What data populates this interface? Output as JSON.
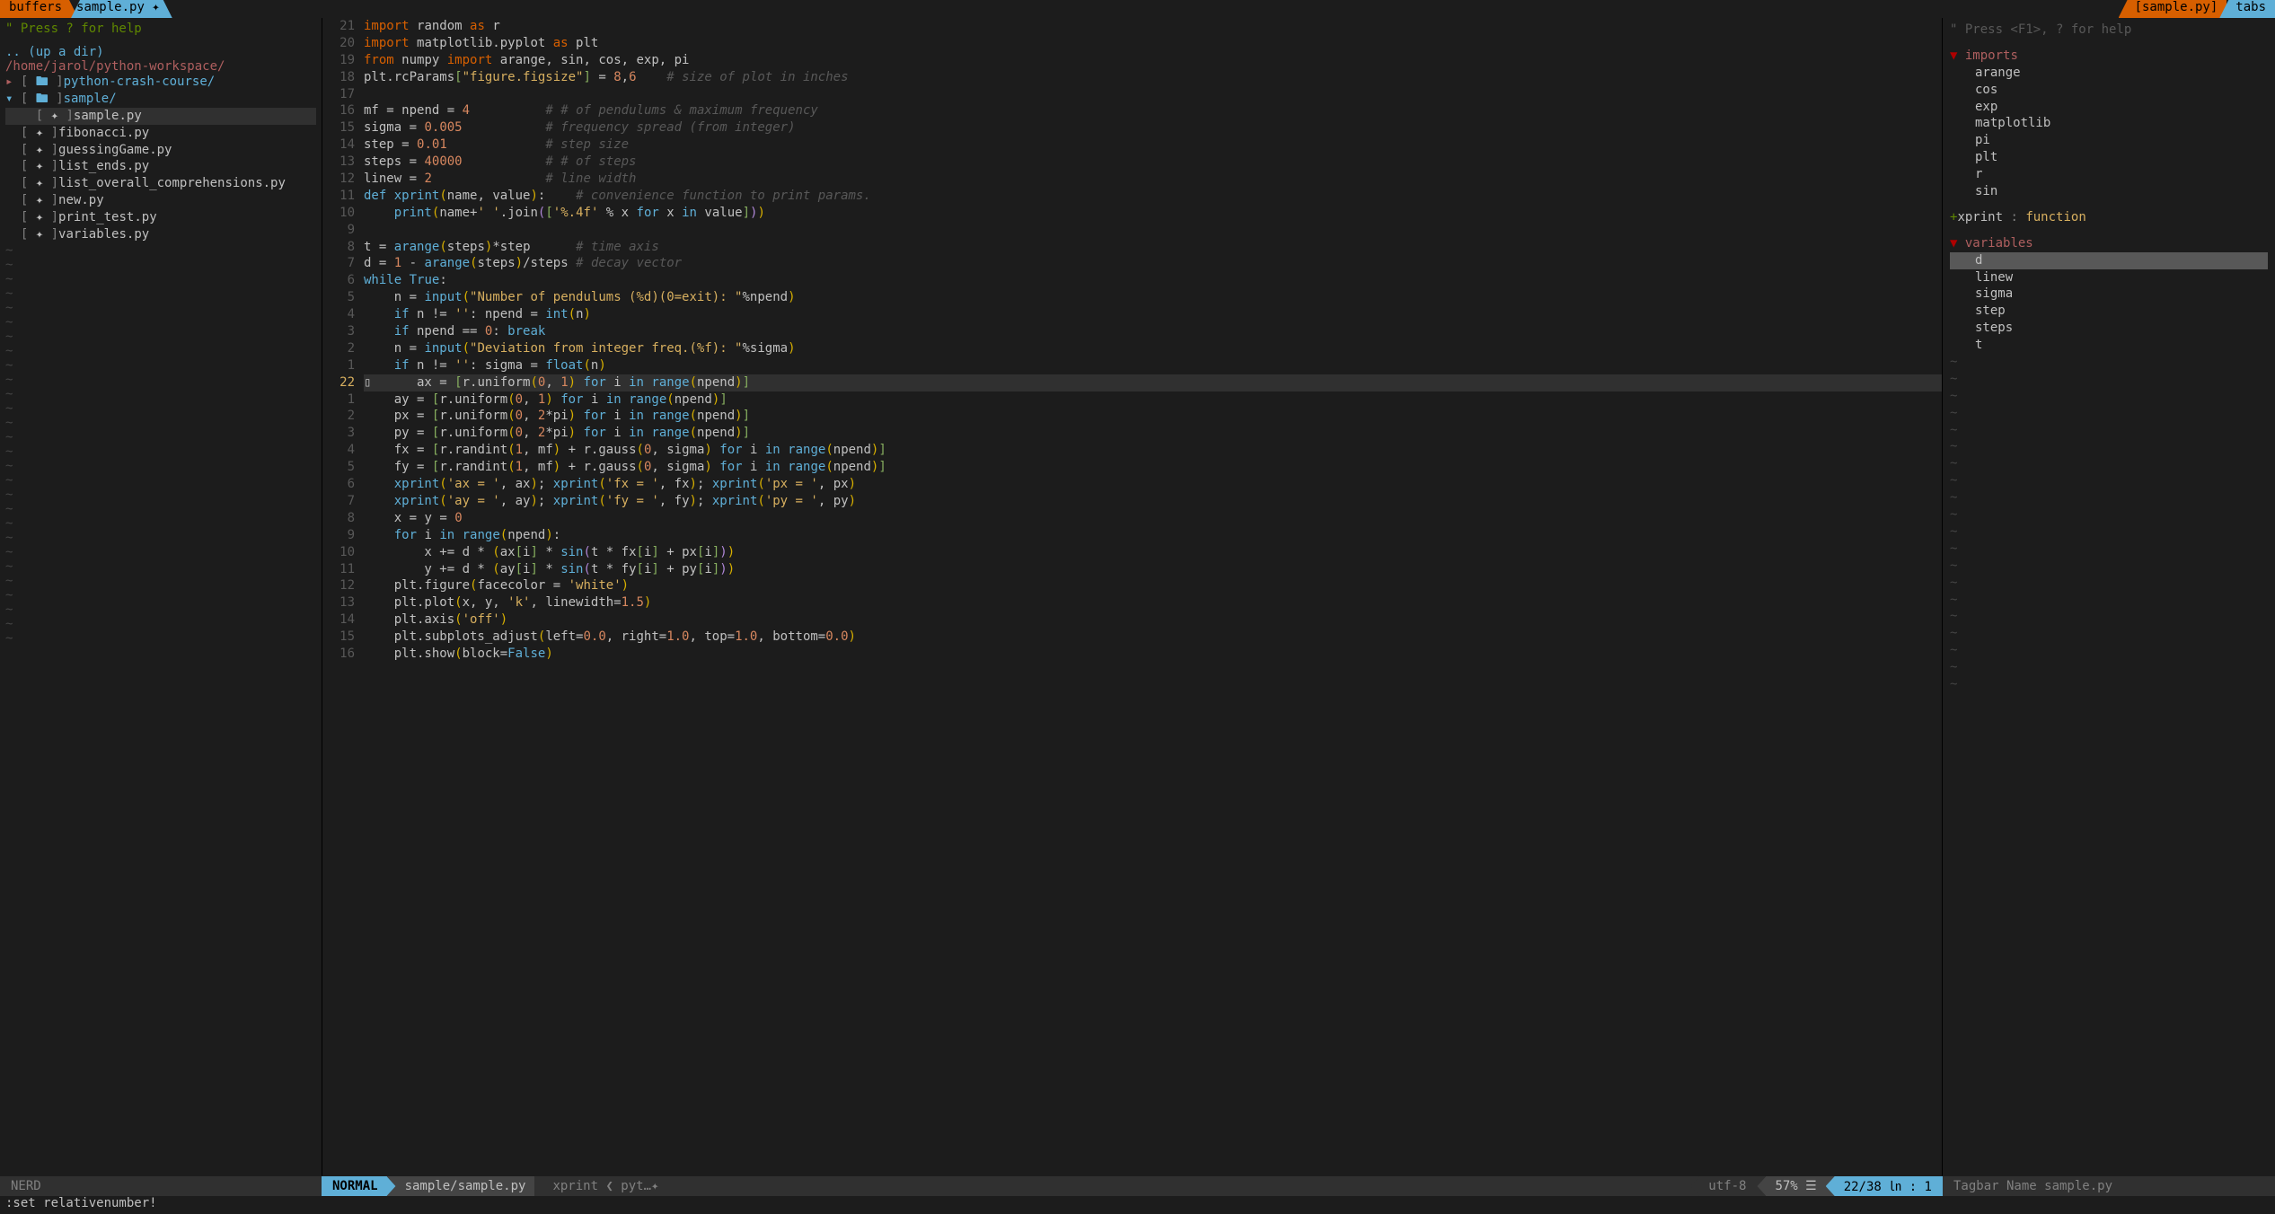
{
  "tabs": {
    "buffers_label": "buffers",
    "current_buffer": "sample.py ✦",
    "right_file": "[sample.py]",
    "tabs_label": "tabs"
  },
  "sidebar": {
    "help": "\" Press ? for help",
    "up_dir": ".. (up a dir)",
    "path": "/home/jarol/python-workspace/",
    "items": [
      {
        "type": "dir",
        "open": false,
        "label": "python-crash-course/"
      },
      {
        "type": "dir",
        "open": true,
        "label": "sample/"
      },
      {
        "type": "file",
        "selected": true,
        "label": "sample.py",
        "indent": 2
      },
      {
        "type": "file",
        "selected": false,
        "label": "fibonacci.py",
        "indent": 1
      },
      {
        "type": "file",
        "selected": false,
        "label": "guessingGame.py",
        "indent": 1
      },
      {
        "type": "file",
        "selected": false,
        "label": "list_ends.py",
        "indent": 1
      },
      {
        "type": "file",
        "selected": false,
        "label": "list_overall_comprehensions.py",
        "indent": 1
      },
      {
        "type": "file",
        "selected": false,
        "label": "new.py",
        "indent": 1
      },
      {
        "type": "file",
        "selected": false,
        "label": "print_test.py",
        "indent": 1
      },
      {
        "type": "file",
        "selected": false,
        "label": "variables.py",
        "indent": 1
      }
    ]
  },
  "editor": {
    "current_abs_line": 22,
    "lines": [
      {
        "n": "21",
        "html": "<span class='imp'>import</span> <span class='var'>random</span> <span class='imp'>as</span> <span class='var'>r</span>"
      },
      {
        "n": "20",
        "html": "<span class='imp'>import</span> <span class='var'>matplotlib.pyplot</span> <span class='imp'>as</span> <span class='var'>plt</span>"
      },
      {
        "n": "19",
        "html": "<span class='imp'>from</span> <span class='var'>numpy</span> <span class='imp'>import</span> <span class='var'>arange, sin, cos, exp, pi</span>"
      },
      {
        "n": "18",
        "html": "<span class='var'>plt.rcParams</span><span class='sq'>[</span><span class='str'>\"figure.figsize\"</span><span class='sq'>]</span> <span class='op'>=</span> <span class='num'>8</span>,<span class='num'>6</span>    <span class='cmt'># size of plot in inches</span>"
      },
      {
        "n": "17",
        "html": ""
      },
      {
        "n": "16",
        "html": "<span class='var'>mf</span> <span class='op'>=</span> <span class='var'>npend</span> <span class='op'>=</span> <span class='num'>4</span>          <span class='cmt'># # of pendulums &amp; maximum frequency</span>"
      },
      {
        "n": "15",
        "html": "<span class='var'>sigma</span> <span class='op'>=</span> <span class='num'>0.005</span>           <span class='cmt'># frequency spread (from integer)</span>"
      },
      {
        "n": "14",
        "html": "<span class='var'>step</span> <span class='op'>=</span> <span class='num'>0.01</span>             <span class='cmt'># step size</span>"
      },
      {
        "n": "13",
        "html": "<span class='var'>steps</span> <span class='op'>=</span> <span class='num'>40000</span>           <span class='cmt'># # of steps</span>"
      },
      {
        "n": "12",
        "html": "<span class='var'>linew</span> <span class='op'>=</span> <span class='num'>2</span>               <span class='cmt'># line width</span>"
      },
      {
        "n": "11",
        "html": "<span class='kw'>def</span> <span class='fn'>xprint</span><span class='br1'>(</span>name, value<span class='br1'>)</span>:    <span class='cmt'># convenience function to print params.</span>"
      },
      {
        "n": "10",
        "html": "    <span class='fn'>print</span><span class='br1'>(</span>name+<span class='str'>' '</span>.join<span class='br2'>(</span><span class='sq'>[</span><span class='str'>'%.4f'</span> % x <span class='kw'>for</span> x <span class='kw'>in</span> value<span class='sq'>]</span><span class='br2'>)</span><span class='br1'>)</span>"
      },
      {
        "n": "9",
        "html": ""
      },
      {
        "n": "8",
        "html": "<span class='var'>t</span> <span class='op'>=</span> <span class='fn'>arange</span><span class='br1'>(</span>steps<span class='br1'>)</span>*step      <span class='cmt'># time axis</span>"
      },
      {
        "n": "7",
        "html": "<span class='var'>d</span> <span class='op'>=</span> <span class='num'>1</span> - <span class='fn'>arange</span><span class='br1'>(</span>steps<span class='br1'>)</span>/steps <span class='cmt'># decay vector</span>"
      },
      {
        "n": "6",
        "html": "<span class='kw'>while</span> <span class='kw'>True</span>:"
      },
      {
        "n": "5",
        "html": "    n <span class='op'>=</span> <span class='fn'>input</span><span class='br1'>(</span><span class='str'>\"Number of pendulums (%d)(0=exit): \"</span>%npend<span class='br1'>)</span>"
      },
      {
        "n": "4",
        "html": "    <span class='kw'>if</span> n != <span class='str'>''</span>: npend <span class='op'>=</span> <span class='fn'>int</span><span class='br1'>(</span>n<span class='br1'>)</span>"
      },
      {
        "n": "3",
        "html": "    <span class='kw'>if</span> npend == <span class='num'>0</span>: <span class='kw'>break</span>"
      },
      {
        "n": "2",
        "html": "    n <span class='op'>=</span> <span class='fn'>input</span><span class='br1'>(</span><span class='str'>\"Deviation from integer freq.(%f): \"</span>%sigma<span class='br1'>)</span>"
      },
      {
        "n": "1",
        "html": "    <span class='kw'>if</span> n != <span class='str'>''</span>: sigma <span class='op'>=</span> <span class='fn'>float</span><span class='br1'>(</span>n<span class='br1'>)</span>"
      },
      {
        "n": "22",
        "current": true,
        "html": "    ax <span class='op'>=</span> <span class='sq'>[</span>r.uniform<span class='br1'>(</span><span class='num'>0</span>, <span class='num'>1</span><span class='br1'>)</span> <span class='kw'>for</span> i <span class='kw'>in</span> <span class='fn'>range</span><span class='br1'>(</span>npend<span class='br1'>)</span><span class='sq'>]</span>"
      },
      {
        "n": "1",
        "html": "    ay <span class='op'>=</span> <span class='sq'>[</span>r.uniform<span class='br1'>(</span><span class='num'>0</span>, <span class='num'>1</span><span class='br1'>)</span> <span class='kw'>for</span> i <span class='kw'>in</span> <span class='fn'>range</span><span class='br1'>(</span>npend<span class='br1'>)</span><span class='sq'>]</span>"
      },
      {
        "n": "2",
        "html": "    px <span class='op'>=</span> <span class='sq'>[</span>r.uniform<span class='br1'>(</span><span class='num'>0</span>, <span class='num'>2</span>*pi<span class='br1'>)</span> <span class='kw'>for</span> i <span class='kw'>in</span> <span class='fn'>range</span><span class='br1'>(</span>npend<span class='br1'>)</span><span class='sq'>]</span>"
      },
      {
        "n": "3",
        "html": "    py <span class='op'>=</span> <span class='sq'>[</span>r.uniform<span class='br1'>(</span><span class='num'>0</span>, <span class='num'>2</span>*pi<span class='br1'>)</span> <span class='kw'>for</span> i <span class='kw'>in</span> <span class='fn'>range</span><span class='br1'>(</span>npend<span class='br1'>)</span><span class='sq'>]</span>"
      },
      {
        "n": "4",
        "html": "    fx <span class='op'>=</span> <span class='sq'>[</span>r.randint<span class='br1'>(</span><span class='num'>1</span>, mf<span class='br1'>)</span> + r.gauss<span class='br1'>(</span><span class='num'>0</span>, sigma<span class='br1'>)</span> <span class='kw'>for</span> i <span class='kw'>in</span> <span class='fn'>range</span><span class='br1'>(</span>npend<span class='br1'>)</span><span class='sq'>]</span>"
      },
      {
        "n": "5",
        "html": "    fy <span class='op'>=</span> <span class='sq'>[</span>r.randint<span class='br1'>(</span><span class='num'>1</span>, mf<span class='br1'>)</span> + r.gauss<span class='br1'>(</span><span class='num'>0</span>, sigma<span class='br1'>)</span> <span class='kw'>for</span> i <span class='kw'>in</span> <span class='fn'>range</span><span class='br1'>(</span>npend<span class='br1'>)</span><span class='sq'>]</span>"
      },
      {
        "n": "6",
        "html": "    <span class='fn'>xprint</span><span class='br1'>(</span><span class='str'>'ax = '</span>, ax<span class='br1'>)</span>; <span class='fn'>xprint</span><span class='br1'>(</span><span class='str'>'fx = '</span>, fx<span class='br1'>)</span>; <span class='fn'>xprint</span><span class='br1'>(</span><span class='str'>'px = '</span>, px<span class='br1'>)</span>"
      },
      {
        "n": "7",
        "html": "    <span class='fn'>xprint</span><span class='br1'>(</span><span class='str'>'ay = '</span>, ay<span class='br1'>)</span>; <span class='fn'>xprint</span><span class='br1'>(</span><span class='str'>'fy = '</span>, fy<span class='br1'>)</span>; <span class='fn'>xprint</span><span class='br1'>(</span><span class='str'>'py = '</span>, py<span class='br1'>)</span>"
      },
      {
        "n": "8",
        "html": "    x <span class='op'>=</span> y <span class='op'>=</span> <span class='num'>0</span>"
      },
      {
        "n": "9",
        "html": "    <span class='kw'>for</span> i <span class='kw'>in</span> <span class='fn'>range</span><span class='br1'>(</span>npend<span class='br1'>)</span>:"
      },
      {
        "n": "10",
        "html": "        x += d * <span class='br1'>(</span>ax<span class='sq'>[</span>i<span class='sq'>]</span> * <span class='fn'>sin</span><span class='br2'>(</span>t * fx<span class='sq'>[</span>i<span class='sq'>]</span> + px<span class='sq'>[</span>i<span class='sq'>]</span><span class='br2'>)</span><span class='br1'>)</span>"
      },
      {
        "n": "11",
        "html": "        y += d * <span class='br1'>(</span>ay<span class='sq'>[</span>i<span class='sq'>]</span> * <span class='fn'>sin</span><span class='br2'>(</span>t * fy<span class='sq'>[</span>i<span class='sq'>]</span> + py<span class='sq'>[</span>i<span class='sq'>]</span><span class='br2'>)</span><span class='br1'>)</span>"
      },
      {
        "n": "12",
        "html": "    plt.figure<span class='br1'>(</span>facecolor <span class='op'>=</span> <span class='str'>'white'</span><span class='br1'>)</span>"
      },
      {
        "n": "13",
        "html": "    plt.plot<span class='br1'>(</span>x, y, <span class='str'>'k'</span>, linewidth=<span class='num'>1.5</span><span class='br1'>)</span>"
      },
      {
        "n": "14",
        "html": "    plt.axis<span class='br1'>(</span><span class='str'>'off'</span><span class='br1'>)</span>"
      },
      {
        "n": "15",
        "html": "    plt.subplots_adjust<span class='br1'>(</span>left=<span class='num'>0.0</span>, right=<span class='num'>1.0</span>, top=<span class='num'>1.0</span>, bottom=<span class='num'>0.0</span><span class='br1'>)</span>"
      },
      {
        "n": "16",
        "html": "    plt.show<span class='br1'>(</span>block=<span class='kw'>False</span><span class='br1'>)</span>"
      }
    ]
  },
  "tagbar": {
    "hint": "\" Press <F1>, ? for help",
    "sections": {
      "imports_label": "imports",
      "imports": [
        "arange",
        "cos",
        "exp",
        "matplotlib",
        "pi",
        "plt",
        "r",
        "sin"
      ],
      "xprint": "+xprint : function",
      "variables_label": "variables",
      "variables": [
        "d",
        "linew",
        "sigma",
        "step",
        "steps",
        "t"
      ]
    }
  },
  "status": {
    "nerd": "NERD",
    "mode": "NORMAL",
    "file": "sample/sample.py",
    "context": "xprint ❮ pyt…✦",
    "encoding": "utf-8 ",
    "percent": "57% ☰",
    "position": "22/38 ㏑ :  1 ",
    "tagbar": "Tagbar   Name   sample.py"
  },
  "cmdline": ":set relativenumber!"
}
